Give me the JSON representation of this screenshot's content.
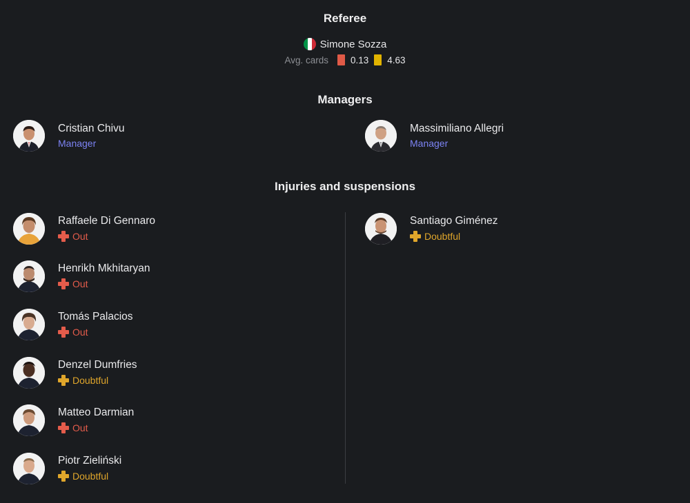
{
  "referee": {
    "heading": "Referee",
    "name": "Simone Sozza",
    "flag_colors": [
      "#009246",
      "#ffffff",
      "#ce2b37"
    ],
    "avg_cards_label": "Avg. cards",
    "red_avg": "0.13",
    "yellow_avg": "4.63"
  },
  "managers": {
    "heading": "Managers",
    "home": {
      "name": "Cristian Chivu",
      "role": "Manager"
    },
    "away": {
      "name": "Massimiliano Allegri",
      "role": "Manager"
    }
  },
  "injuries": {
    "heading": "Injuries and suspensions",
    "home": [
      {
        "name": "Raffaele Di Gennaro",
        "status": "Out"
      },
      {
        "name": "Henrikh Mkhitaryan",
        "status": "Out"
      },
      {
        "name": "Tomás Palacios",
        "status": "Out"
      },
      {
        "name": "Denzel Dumfries",
        "status": "Doubtful"
      },
      {
        "name": "Matteo Darmian",
        "status": "Out"
      },
      {
        "name": "Piotr Zieliński",
        "status": "Doubtful"
      }
    ],
    "away": [
      {
        "name": "Santiago Giménez",
        "status": "Doubtful"
      }
    ]
  },
  "colors": {
    "background": "#1a1c1f",
    "manager_role": "#7c83f4",
    "status_out": "#e45c4b",
    "status_doubtful": "#e0a62b",
    "red_card": "#e05a47",
    "yellow_card": "#e2b400"
  }
}
